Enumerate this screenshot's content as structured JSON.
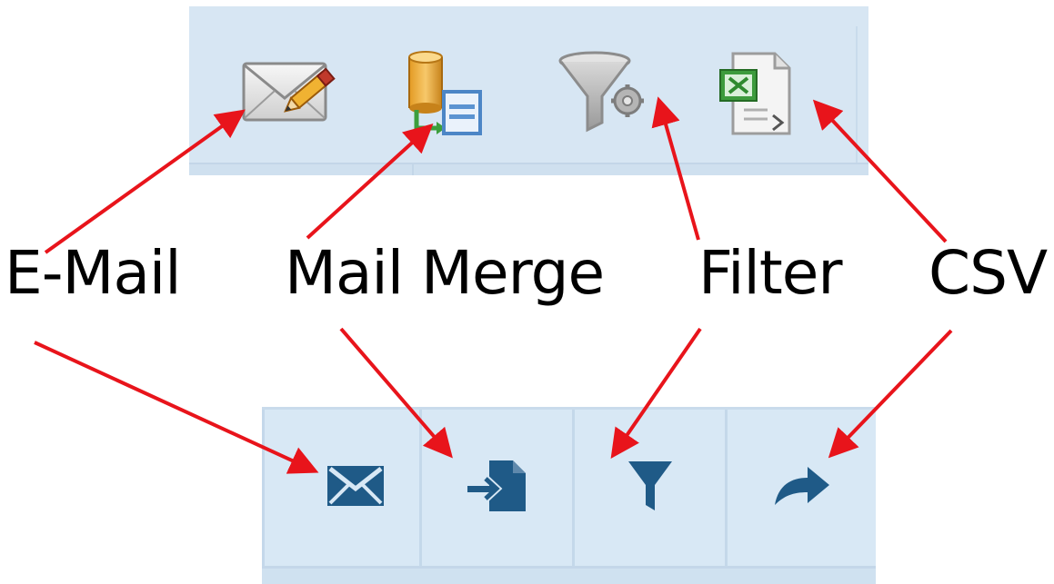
{
  "labels": {
    "email": "E-Mail",
    "mail_merge": "Mail Merge",
    "filter": "Filter",
    "csv": "CSV"
  },
  "toolbars": {
    "old": {
      "buttons": [
        {
          "name": "email",
          "icon": "envelope-pencil-icon"
        },
        {
          "name": "mail-merge",
          "icon": "database-document-icon"
        },
        {
          "name": "filter",
          "icon": "funnel-gear-icon"
        },
        {
          "name": "csv",
          "icon": "spreadsheet-export-icon"
        }
      ]
    },
    "new": {
      "buttons": [
        {
          "name": "email",
          "icon": "envelope-icon"
        },
        {
          "name": "mail-merge",
          "icon": "document-import-icon"
        },
        {
          "name": "filter",
          "icon": "funnel-icon"
        },
        {
          "name": "csv",
          "icon": "share-arrow-icon"
        }
      ]
    }
  },
  "colors": {
    "arrow": "#e8141b",
    "toolbar_bg": "#d7e6f3",
    "new_icon": "#1f5a87"
  }
}
